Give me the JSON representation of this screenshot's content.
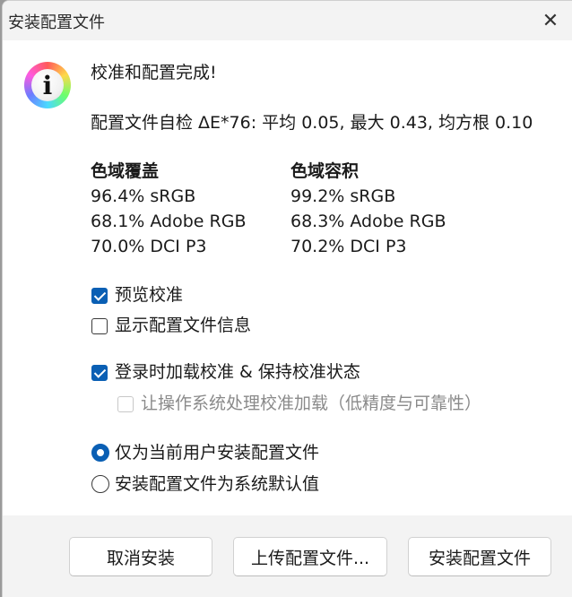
{
  "window": {
    "title": "安装配置文件"
  },
  "message": {
    "heading": "校准和配置完成!",
    "selfcheck": "配置文件自检 ΔE*76: 平均 0.05, 最大 0.43, 均方根 0.10"
  },
  "gamut": {
    "coverage": {
      "header": "色域覆盖",
      "rows": [
        "96.4% sRGB",
        "68.1% Adobe RGB",
        "70.0% DCI P3"
      ]
    },
    "volume": {
      "header": "色域容积",
      "rows": [
        "99.2% sRGB",
        "68.3% Adobe RGB",
        "70.2% DCI P3"
      ]
    }
  },
  "options": {
    "preview": {
      "label": "预览校准",
      "checked": true
    },
    "show_info": {
      "label": "显示配置文件信息",
      "checked": false
    },
    "load_on_login": {
      "label": "登录时加载校准 & 保持校准状态",
      "checked": true
    },
    "os_handle": {
      "label": "让操作系统处理校准加载（低精度与可靠性）",
      "checked": false,
      "disabled": true
    }
  },
  "install_scope": {
    "current_user": {
      "label": "仅为当前用户安装配置文件",
      "selected": true
    },
    "system_default": {
      "label": "安装配置文件为系统默认值",
      "selected": false
    }
  },
  "buttons": {
    "cancel": "取消安装",
    "upload": "上传配置文件...",
    "install": "安装配置文件"
  },
  "colors": {
    "accent": "#0a5fb4",
    "titlebar": "#f3f3f3",
    "footer": "#f3f3f3"
  }
}
